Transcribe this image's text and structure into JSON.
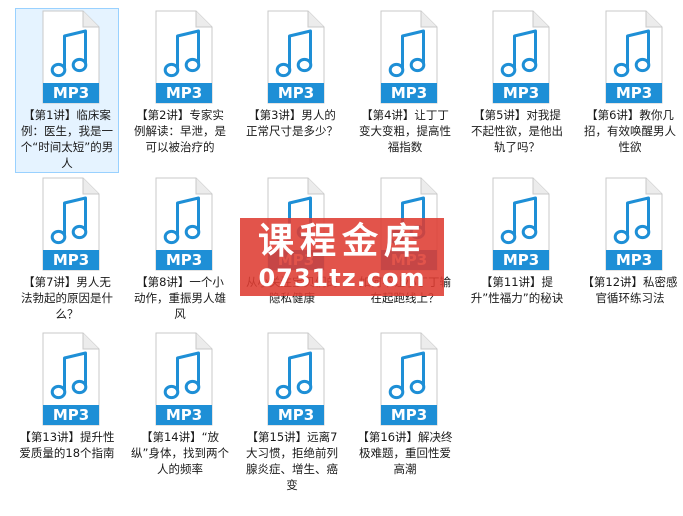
{
  "files": [
    {
      "label": "【第1讲】临床案例：医生，我是一个“时间太短”的男人",
      "badge": "MP3",
      "icon": "music-note-icon",
      "selected": true
    },
    {
      "label": "【第2讲】专家实例解读：早泄，是可以被治疗的",
      "badge": "MP3",
      "icon": "music-note-icon",
      "selected": false
    },
    {
      "label": "【第3讲】男人的正常尺寸是多少？",
      "badge": "MP3",
      "icon": "music-note-icon",
      "selected": false
    },
    {
      "label": "【第4讲】让丁丁变大变粗，提高性福指数",
      "badge": "MP3",
      "icon": "music-note-icon",
      "selected": false
    },
    {
      "label": "【第5讲】对我提不起性欲，是他出轨了吗？",
      "badge": "MP3",
      "icon": "music-note-icon",
      "selected": false
    },
    {
      "label": "【第6讲】教你几招，有效唤醒男人性欲",
      "badge": "MP3",
      "icon": "music-note-icon",
      "selected": false
    },
    {
      "label": "【第7讲】男人无法勃起的原因是什么？",
      "badge": "MP3",
      "icon": "music-note-icon",
      "selected": false
    },
    {
      "label": "【第8讲】一个小动作，重振男人雄风",
      "badge": "MP3",
      "icon": "music-note-icon",
      "selected": false
    },
    {
      "label": "从小关注宝贝们的隐私健康",
      "badge": "MP3",
      "icon": "music-note-icon",
      "selected": false
    },
    {
      "label": "如何不让小丁丁输在起跑线上？",
      "badge": "MP3",
      "icon": "music-note-icon",
      "selected": false
    },
    {
      "label": "【第11讲】提升”性福力”的秘诀",
      "badge": "MP3",
      "icon": "music-note-icon",
      "selected": false
    },
    {
      "label": "【第12讲】私密感官循环练习法",
      "badge": "MP3",
      "icon": "music-note-icon",
      "selected": false
    },
    {
      "label": "【第13讲】提升性爱质量的18个指南",
      "badge": "MP3",
      "icon": "music-note-icon",
      "selected": false
    },
    {
      "label": "【第14讲】“放纵”身体，找到两个人的频率",
      "badge": "MP3",
      "icon": "music-note-icon",
      "selected": false
    },
    {
      "label": "【第15讲】远离7大习惯，拒绝前列腺炎症、增生、癌变",
      "badge": "MP3",
      "icon": "music-note-icon",
      "selected": false
    },
    {
      "label": "【第16讲】解决终极难题，重回性爱高潮",
      "badge": "MP3",
      "icon": "music-note-icon",
      "selected": false
    }
  ],
  "watermark": {
    "title": "课程金库",
    "url": "0731tz.com"
  },
  "colors": {
    "icon_blue": "#1e8fd6",
    "badge_text": "#ffffff",
    "selection_bg": "#e5f3ff",
    "selection_border": "#99d1ff",
    "watermark": "#de3c32"
  }
}
